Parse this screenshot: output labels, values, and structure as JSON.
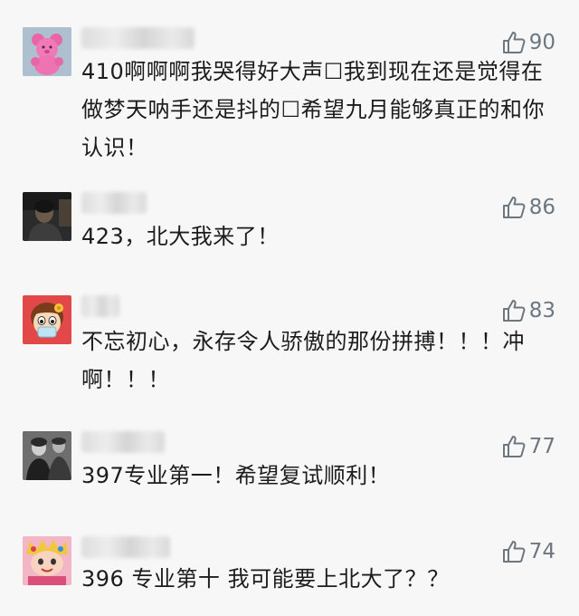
{
  "comments": [
    {
      "avatar": "pink-teddy-bear-avatar",
      "likes": "90",
      "text": "410啊啊啊我哭得好大声☐我到现在还是觉得在做梦天呐手还是抖的☐希望九月能够真正的和你认识！"
    },
    {
      "avatar": "dark-portrait-avatar",
      "likes": "86",
      "text": "423，北大我来了！"
    },
    {
      "avatar": "cartoon-girl-mask-avatar",
      "likes": "83",
      "text": "不忘初心，永存令人骄傲的那份拼搏！！！冲啊！！！"
    },
    {
      "avatar": "black-white-movie-still-avatar",
      "likes": "77",
      "text": "397专业第一！希望复试顺利！"
    },
    {
      "avatar": "cartoon-character-avatar",
      "likes": "74",
      "text": "396 专业第十 我可能要上北大了？？"
    }
  ],
  "colors": {
    "background": "#f7f7f7",
    "like_icon": "#6d7780",
    "text": "#1c1c1c"
  }
}
